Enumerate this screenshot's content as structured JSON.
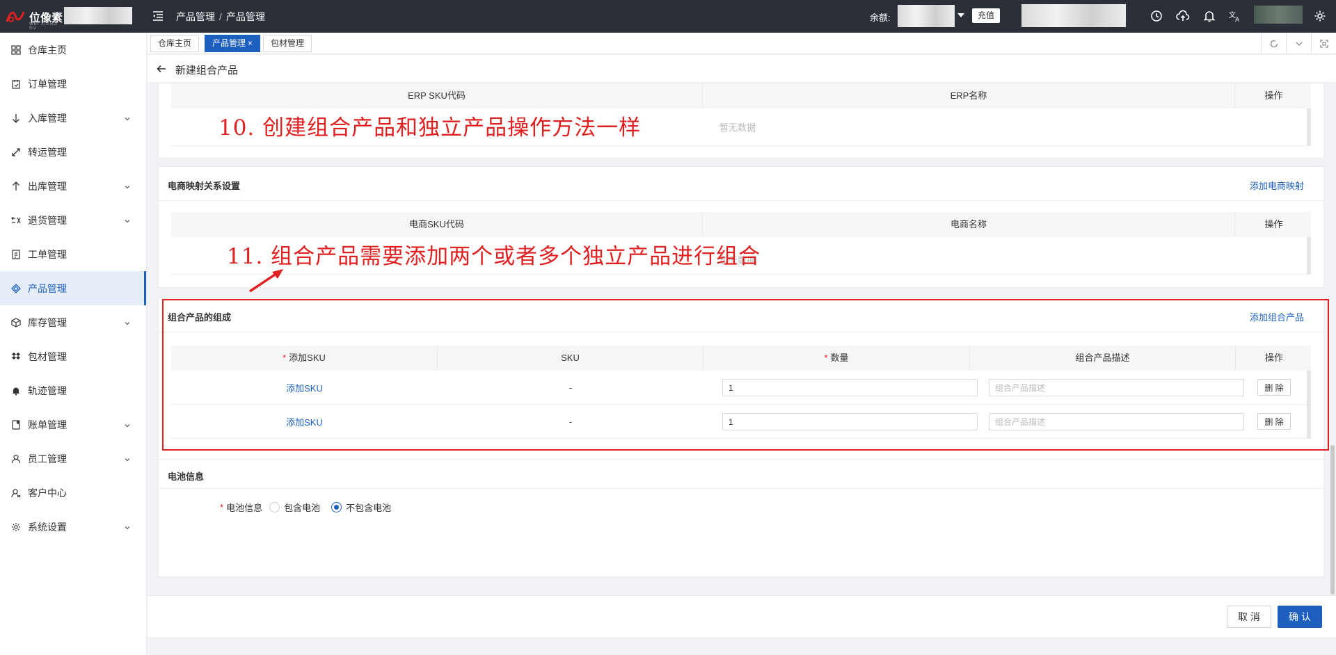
{
  "topbar": {
    "logo_text": "位像素",
    "logo_sub": "WEI XIANG SU",
    "breadcrumb": [
      "产品管理",
      "产品管理"
    ],
    "breadcrumb_sep": "/",
    "balance_label": "余额:",
    "recharge_label": "充值"
  },
  "sidebar": {
    "items": [
      {
        "label": "仓库主页",
        "icon": "grid-icon",
        "expandable": false,
        "active": false
      },
      {
        "label": "订单管理",
        "icon": "order-icon",
        "expandable": false,
        "active": false
      },
      {
        "label": "入库管理",
        "icon": "arrow-down-icon",
        "expandable": true,
        "active": false
      },
      {
        "label": "转运管理",
        "icon": "transfer-icon",
        "expandable": false,
        "active": false
      },
      {
        "label": "出库管理",
        "icon": "arrow-up-icon",
        "expandable": true,
        "active": false
      },
      {
        "label": "退货管理",
        "icon": "return-icon",
        "expandable": true,
        "active": false
      },
      {
        "label": "工单管理",
        "icon": "ticket-icon",
        "expandable": false,
        "active": false
      },
      {
        "label": "产品管理",
        "icon": "product-icon",
        "expandable": false,
        "active": true
      },
      {
        "label": "库存管理",
        "icon": "box-icon",
        "expandable": true,
        "active": false
      },
      {
        "label": "包材管理",
        "icon": "dropbox-icon",
        "expandable": false,
        "active": false
      },
      {
        "label": "轨迹管理",
        "icon": "bell-icon",
        "expandable": false,
        "active": false
      },
      {
        "label": "账单管理",
        "icon": "bill-icon",
        "expandable": true,
        "active": false
      },
      {
        "label": "员工管理",
        "icon": "user-icon",
        "expandable": true,
        "active": false
      },
      {
        "label": "客户中心",
        "icon": "customer-icon",
        "expandable": false,
        "active": false
      },
      {
        "label": "系统设置",
        "icon": "gear-icon",
        "expandable": true,
        "active": false
      }
    ]
  },
  "tabs": [
    {
      "label": "仓库主页",
      "active": false
    },
    {
      "label": "产品管理",
      "active": true,
      "close": "×"
    },
    {
      "label": "包材管理",
      "active": false
    }
  ],
  "page": {
    "title": "新建组合产品"
  },
  "erp_section": {
    "columns": [
      "ERP SKU代码",
      "ERP名称",
      "操作"
    ],
    "empty_text": "暂无数据"
  },
  "ecom_section": {
    "title": "电商映射关系设置",
    "add_link": "添加电商映射",
    "columns": [
      "电商SKU代码",
      "电商名称",
      "操作"
    ],
    "empty_text": "暂无数据"
  },
  "combo_section": {
    "title": "组合产品的组成",
    "add_link": "添加组合产品",
    "required_mark": "*",
    "columns": [
      "添加SKU",
      "SKU",
      "数量",
      "组合产品描述",
      "操作"
    ],
    "rows": [
      {
        "add_sku": "添加SKU",
        "sku": "-",
        "quantity": "1",
        "desc_placeholder": "组合产品描述",
        "delete": "删 除"
      },
      {
        "add_sku": "添加SKU",
        "sku": "-",
        "quantity": "1",
        "desc_placeholder": "组合产品描述",
        "delete": "删 除"
      }
    ]
  },
  "battery_section": {
    "title": "电池信息",
    "field_label": "电池信息",
    "options": [
      {
        "label": "包含电池",
        "selected": false
      },
      {
        "label": "不包含电池",
        "selected": true
      }
    ]
  },
  "annotations": {
    "step10": "10. 创建组合产品和独立产品操作方法一样",
    "step11": "11. 组合产品需要添加两个或者多个独立产品进行组合"
  },
  "footer": {
    "cancel_label": "取 消",
    "confirm_label": "确 认"
  },
  "colors": {
    "accent": "#1d5fbf",
    "topbar": "#2b3038",
    "annotation": "#e02020"
  }
}
